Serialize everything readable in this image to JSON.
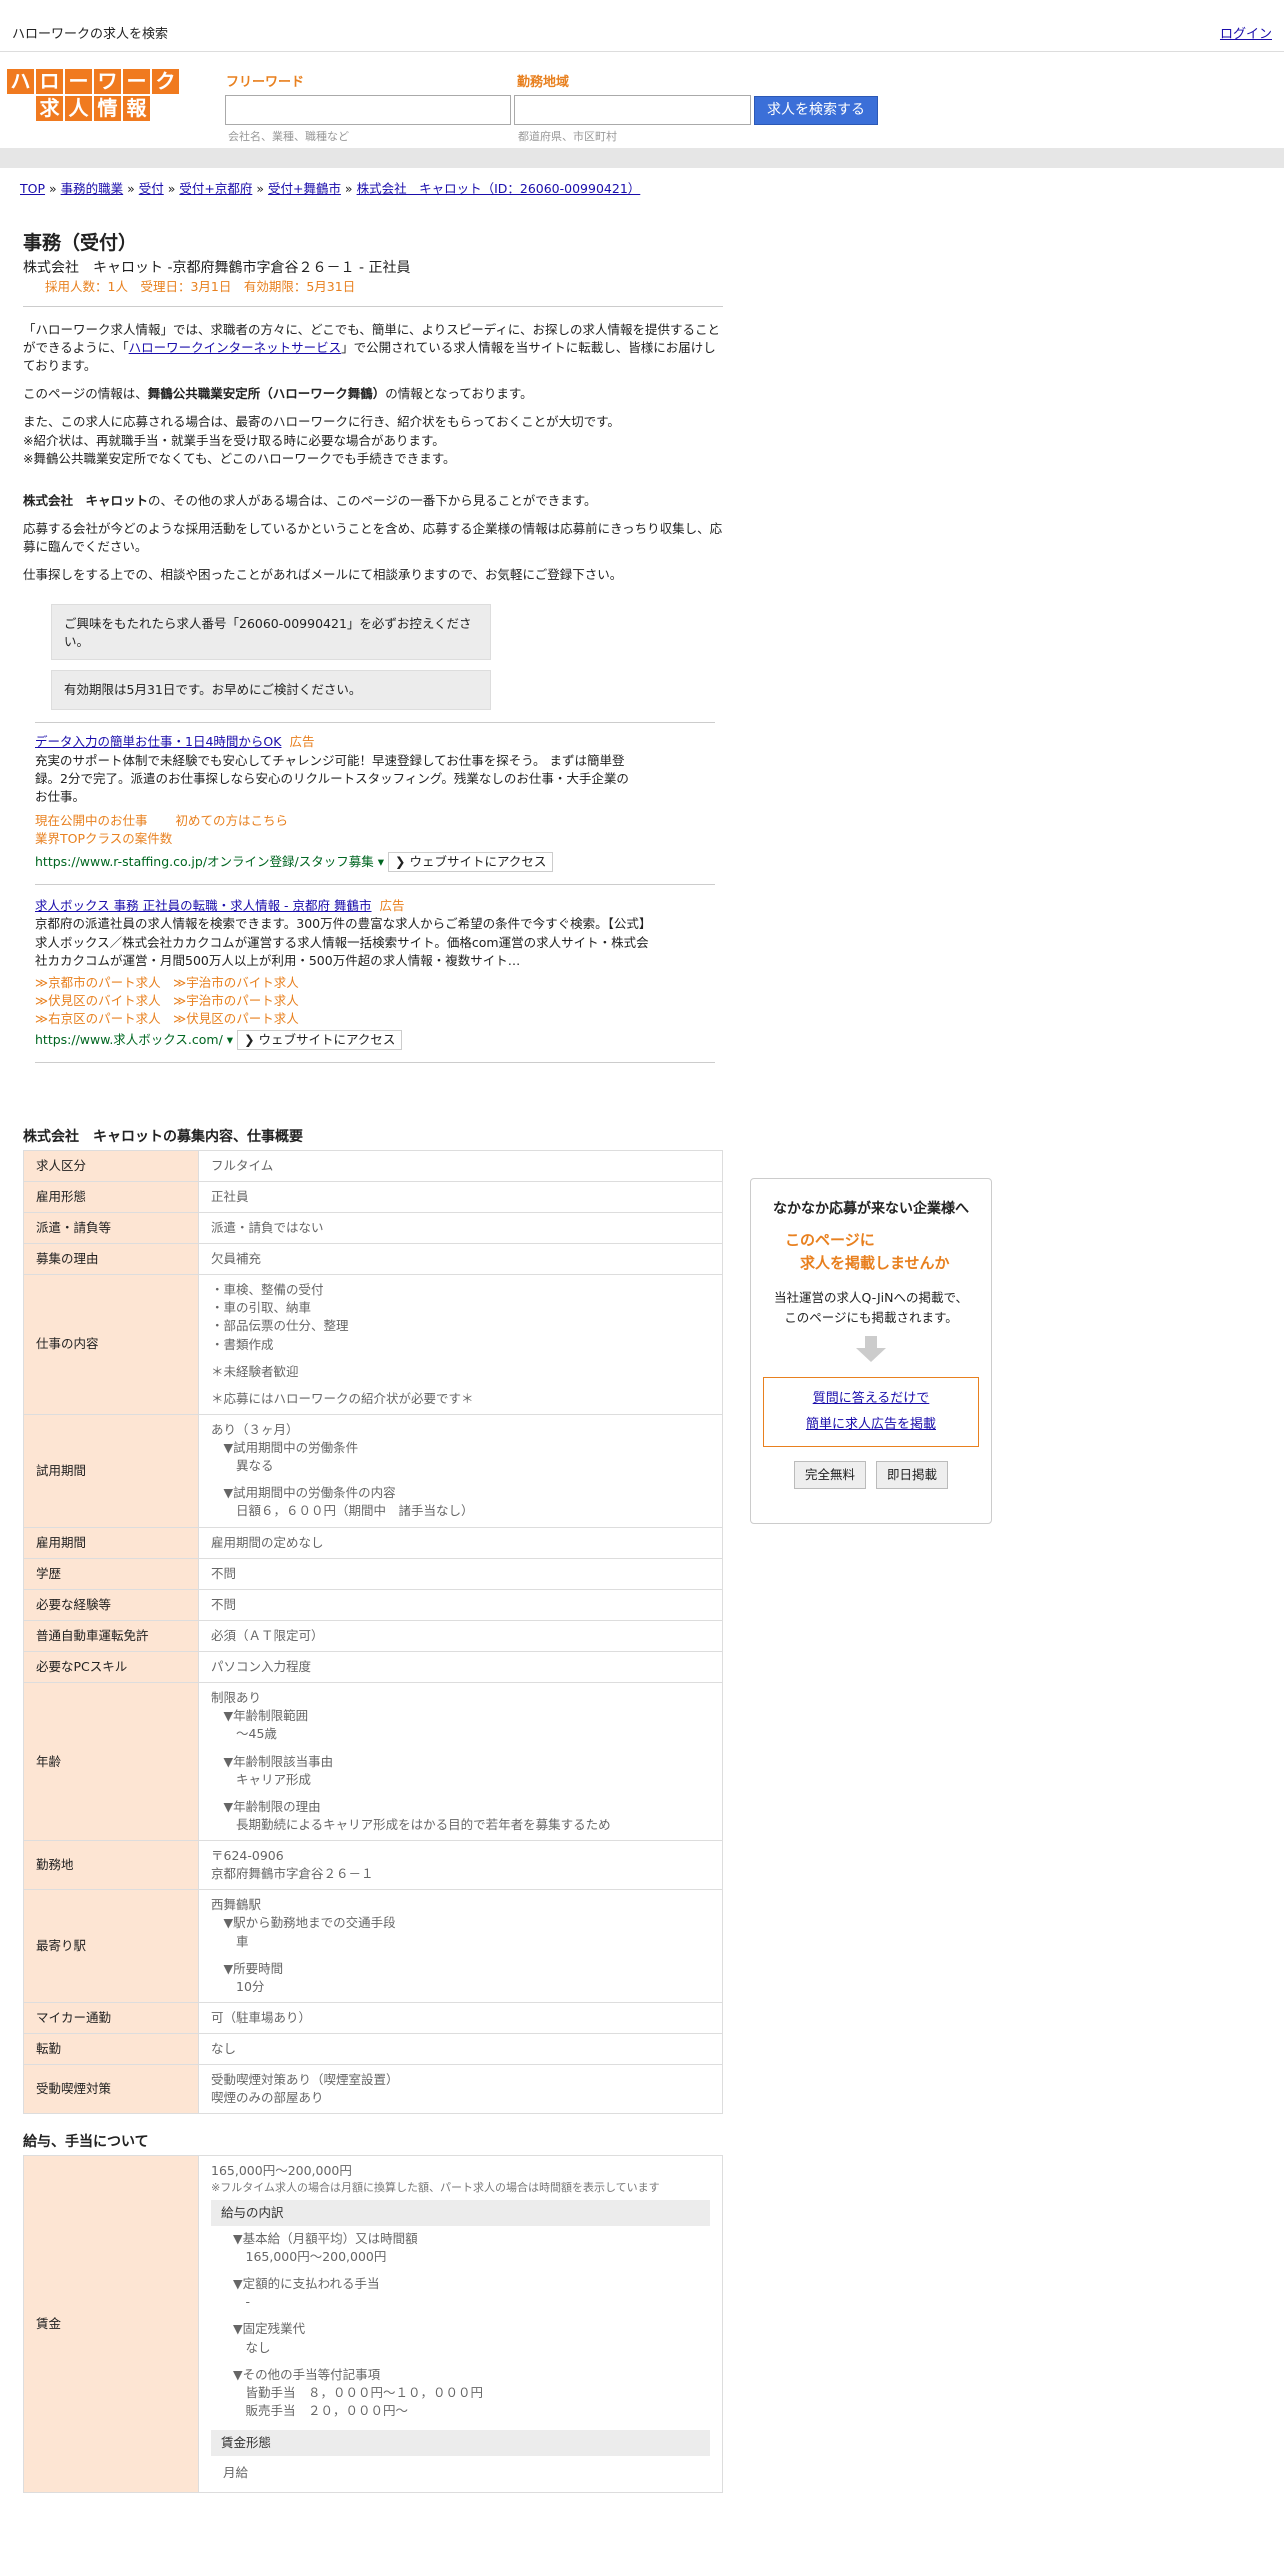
{
  "topbar": {
    "title": "ハローワークの求人を検索",
    "login": "ログイン"
  },
  "logo": {
    "row1": [
      "ハ",
      "ロ",
      "ー",
      "ワ",
      "ー",
      "ク"
    ],
    "row2": [
      "求",
      "人",
      "情",
      "報"
    ]
  },
  "search": {
    "keyword_label": "フリーワード",
    "keyword_hint": "会社名、業種、職種など",
    "area_label": "勤務地域",
    "area_hint": "都道府県、市区町村",
    "button": "求人を検索する"
  },
  "breadcrumb": [
    "TOP",
    "事務的職業",
    "受付",
    "受付+京都府",
    "受付+舞鶴市",
    "株式会社　キャロット（ID：26060-00990421）"
  ],
  "job": {
    "title": "事務（受付）",
    "company_line": "株式会社　キャロット -京都府舞鶴市字倉谷２６－１ - 正社員",
    "meta": "採用人数：1人　受理日：3月1日　有効期限：5月31日"
  },
  "intro": {
    "p1a": "「ハローワーク求人情報」では、求職者の方々に、どこでも、簡単に、よりスピーディに、お探しの求人情報を提供することができるように、「",
    "p1link": "ハローワークインターネットサービス",
    "p1b": "」で公開されている求人情報を当サイトに転載し、皆様にお届けしております。",
    "p2a": "このページの情報は、",
    "p2bold": "舞鶴公共職業安定所（ハローワーク舞鶴）",
    "p2b": "の情報となっております。",
    "p3": "また、この求人に応募される場合は、最寄のハローワークに行き、紹介状をもらっておくことが大切です。",
    "p4": "※紹介状は、再就職手当・就業手当を受け取る時に必要な場合があります。",
    "p5": "※舞鶴公共職業安定所でなくても、どこのハローワークでも手続きできます。",
    "p6bold": "株式会社　キャロット",
    "p6": "の、その他の求人がある場合は、このページの一番下から見ることができます。",
    "p7": "応募する会社が今どのような採用活動をしているかということを含め、応募する企業様の情報は応募前にきっちり収集し、応募に臨んでください。",
    "p8": "仕事探しをする上での、相談や困ったことがあればメールにて相談承りますので、お気軽にご登録下さい。"
  },
  "notices": [
    "ご興味をもたれたら求人番号「26060-00990421」を必ずお控えください。",
    "有効期限は5月31日です。お早めにご検討ください。"
  ],
  "ads": [
    {
      "title": "データ入力の簡単お仕事・1日4時間からOK",
      "tag": "広告",
      "desc": "充実のサポート体制で未経験でも安心してチャレンジ可能！早速登録してお仕事を探そう。 まずは簡単登録。2分で完了。派遣のお仕事探しなら安心のリクルートスタッフィング。残業なしのお仕事・大手企業のお仕事。",
      "links": [
        "現在公開中のお仕事",
        "初めての方はこちら",
        "業界TOPクラスの案件数"
      ],
      "url": "https://www.r-staffing.co.jp/オンライン登録/スタッフ募集",
      "visit": "❯ ウェブサイトにアクセス"
    },
    {
      "title": "求人ボックス 事務 正社員の転職・求人情報 - 京都府 舞鶴市",
      "tag": "広告",
      "desc": "京都府の派遣社員の求人情報を検索できます。300万件の豊富な求人からご希望の条件で今すぐ検索。【公式】求人ボックス／株式会社カカクコムが運営する求人情報一括検索サイト。価格com運営の求人サイト・株式会社カカクコムが運営・月間500万人以上が利用・500万件超の求人情報・複数サイト…",
      "links": [
        "≫京都市のパート求人",
        "≫宇治市のバイト求人",
        "≫伏見区のバイト求人",
        "≫宇治市のパート求人",
        "≫右京区のパート求人",
        "≫伏見区のパート求人"
      ],
      "url": "https://www.求人ボックス.com/",
      "visit": "❯ ウェブサイトにアクセス"
    }
  ],
  "overview": {
    "title": "株式会社　キャロットの募集内容、仕事概要",
    "rows": [
      {
        "label": "求人区分",
        "lines": [
          "フルタイム"
        ]
      },
      {
        "label": "雇用形態",
        "lines": [
          "正社員"
        ]
      },
      {
        "label": "派遣・請負等",
        "lines": [
          "派遣・請負ではない"
        ]
      },
      {
        "label": "募集の理由",
        "lines": [
          "欠員補充"
        ]
      },
      {
        "label": "仕事の内容",
        "lines": [
          "・車検、整備の受付",
          "・車の引取、納車",
          "・部品伝票の仕分、整理",
          "・書類作成",
          "",
          "＊未経験者歓迎",
          "",
          "＊応募にはハローワークの紹介状が必要です＊"
        ]
      },
      {
        "label": "試用期間",
        "lines": [
          "あり（３ヶ月）",
          "　▼試用期間中の労働条件",
          "　　異なる",
          "",
          "　▼試用期間中の労働条件の内容",
          "　　日額６，６００円（期間中　諸手当なし）"
        ]
      },
      {
        "label": "雇用期間",
        "lines": [
          "雇用期間の定めなし"
        ]
      },
      {
        "label": "学歴",
        "lines": [
          "不問"
        ]
      },
      {
        "label": "必要な経験等",
        "lines": [
          "不問"
        ]
      },
      {
        "label": "普通自動車運転免許",
        "lines": [
          "必須（ＡＴ限定可）"
        ]
      },
      {
        "label": "必要なPCスキル",
        "lines": [
          "パソコン入力程度"
        ]
      },
      {
        "label": "年齢",
        "lines": [
          "制限あり",
          "　▼年齢制限範囲",
          "　　〜45歳",
          "",
          "　▼年齢制限該当事由",
          "　　キャリア形成",
          "",
          "　▼年齢制限の理由",
          "　　長期勤続によるキャリア形成をはかる目的で若年者を募集するため"
        ]
      },
      {
        "label": "勤務地",
        "lines": [
          "〒624-0906",
          "京都府舞鶴市字倉谷２６－１"
        ]
      },
      {
        "label": "最寄り駅",
        "lines": [
          "西舞鶴駅",
          "　▼駅から勤務地までの交通手段",
          "　　車",
          "",
          "　▼所要時間",
          "　　10分"
        ]
      },
      {
        "label": "マイカー通勤",
        "lines": [
          "可（駐車場あり）"
        ]
      },
      {
        "label": "転勤",
        "lines": [
          "なし"
        ]
      },
      {
        "label": "受動喫煙対策",
        "lines": [
          "受動喫煙対策あり（喫煙室設置）",
          "喫煙のみの部屋あり"
        ]
      }
    ]
  },
  "salary": {
    "title": "給与、手当について",
    "label": "賃金",
    "range": "165,000円〜200,000円",
    "note": "※フルタイム求人の場合は月額に換算した額、パート求人の場合は時間額を表示しています",
    "breakdown_head": "給与の内訳",
    "breakdown": [
      "▼基本給（月額平均）又は時間額",
      "　165,000円〜200,000円",
      "",
      "▼定額的に支払われる手当",
      "　-",
      "",
      "▼固定残業代",
      "　なし",
      "",
      "▼その他の手当等付記事項",
      "　皆勤手当　８，０００円〜１０，０００円",
      "　販売手当　２０，０００円〜"
    ],
    "form_head": "賃金形態",
    "form": "月給"
  },
  "sidebox": {
    "title": "なかなか応募が来ない企業様へ",
    "orange1": "このページに",
    "orange2": "　求人を掲載しませんか",
    "text1": "当社運営の求人Q-JiNへの掲載で、",
    "text2": "このページにも掲載されます。",
    "link1": "質問に答えるだけで",
    "link2": "簡単に求人広告を掲載",
    "btn1": "完全無料",
    "btn2": "即日掲載"
  }
}
